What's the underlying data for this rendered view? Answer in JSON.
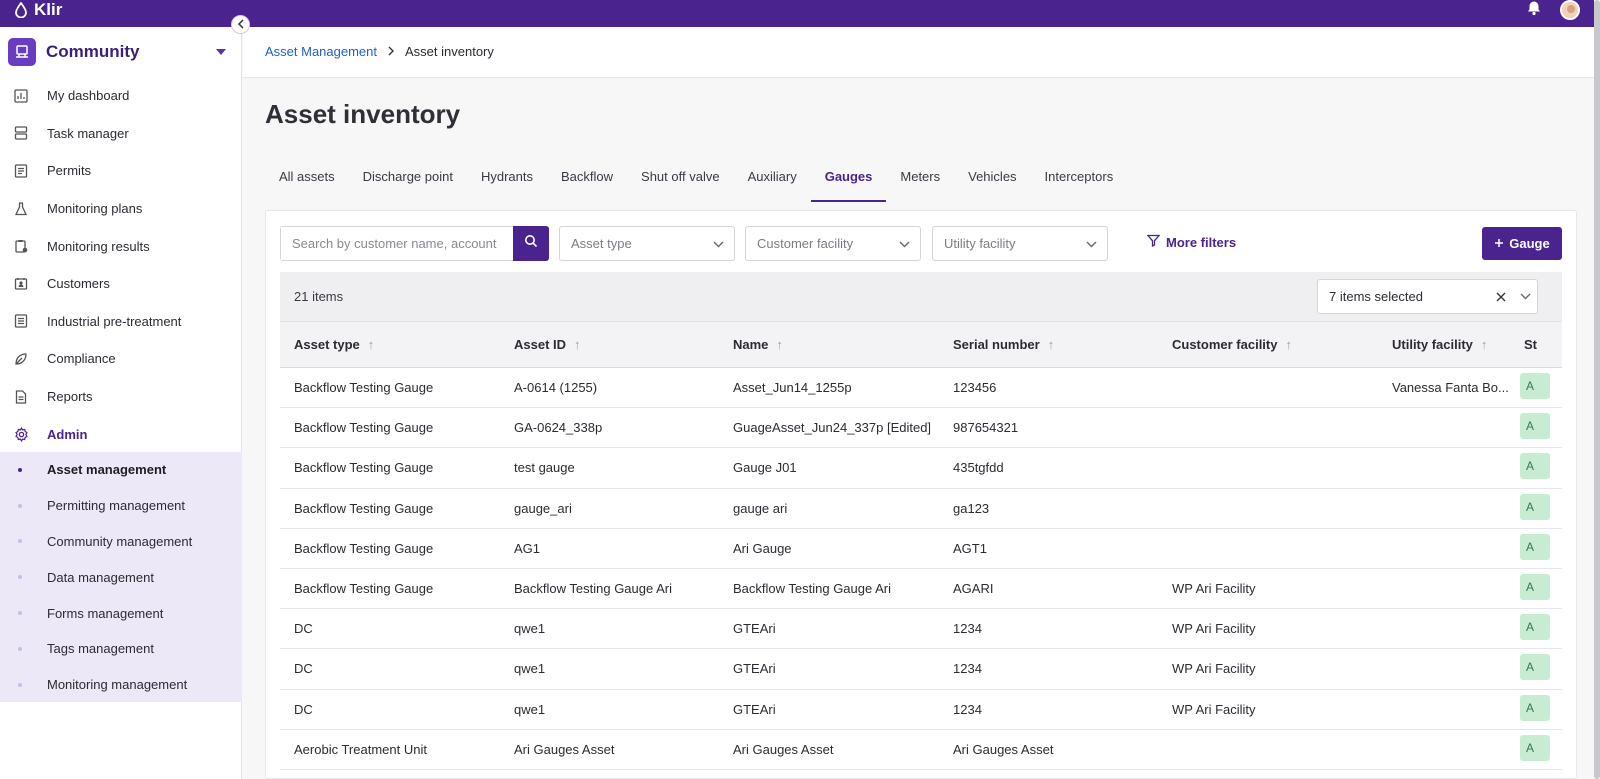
{
  "app": {
    "name": "Klir"
  },
  "sidebar": {
    "community_label": "Community",
    "items": [
      {
        "label": "My dashboard",
        "icon": "chart-icon"
      },
      {
        "label": "Task manager",
        "icon": "tasks-icon"
      },
      {
        "label": "Permits",
        "icon": "document-icon"
      },
      {
        "label": "Monitoring plans",
        "icon": "flask-icon"
      },
      {
        "label": "Monitoring results",
        "icon": "clipboard-icon"
      },
      {
        "label": "Customers",
        "icon": "contacts-icon"
      },
      {
        "label": "Industrial pre-treatment",
        "icon": "list-icon"
      },
      {
        "label": "Compliance",
        "icon": "leaf-icon"
      },
      {
        "label": "Reports",
        "icon": "report-icon"
      },
      {
        "label": "Admin",
        "icon": "gear-icon"
      }
    ],
    "admin_items": [
      "Asset management",
      "Permitting management",
      "Community management",
      "Data management",
      "Forms management",
      "Tags management",
      "Monitoring management"
    ]
  },
  "breadcrumb": {
    "parent": "Asset Management",
    "current": "Asset inventory"
  },
  "page_title": "Asset inventory",
  "tabs": [
    "All assets",
    "Discharge point",
    "Hydrants",
    "Backflow",
    "Shut off valve",
    "Auxiliary",
    "Gauges",
    "Meters",
    "Vehicles",
    "Interceptors"
  ],
  "active_tab": "Gauges",
  "filters": {
    "search_placeholder": "Search by customer name, account",
    "asset_type": "Asset type",
    "customer_facility": "Customer facility",
    "utility_facility": "Utility facility",
    "more_filters": "More filters",
    "add_button": "Gauge"
  },
  "table": {
    "items_count": "21 items",
    "columns_selected": "7 items selected",
    "columns": [
      "Asset type",
      "Asset ID",
      "Name",
      "Serial number",
      "Customer facility",
      "Utility facility",
      "St"
    ],
    "rows": [
      [
        "Backflow Testing Gauge",
        "A-0614 (1255)",
        "Asset_Jun14_1255p",
        "123456",
        "",
        "Vanessa Fanta Bo...",
        "A"
      ],
      [
        "Backflow Testing Gauge",
        "GA-0624_338p",
        "GuageAsset_Jun24_337p [Edited]",
        "987654321",
        "",
        "",
        "A"
      ],
      [
        "Backflow Testing Gauge",
        "test gauge",
        "Gauge J01",
        "435tgfdd",
        "",
        "",
        "A"
      ],
      [
        "Backflow Testing Gauge",
        "gauge_ari",
        "gauge ari",
        "ga123",
        "",
        "",
        "A"
      ],
      [
        "Backflow Testing Gauge",
        "AG1",
        "Ari Gauge",
        "AGT1",
        "",
        "",
        "A"
      ],
      [
        "Backflow Testing Gauge",
        "Backflow Testing Gauge Ari",
        "Backflow Testing Gauge Ari",
        "AGARI",
        "WP Ari Facility",
        "",
        "A"
      ],
      [
        "DC",
        "qwe1",
        "GTEAri",
        "1234",
        "WP Ari Facility",
        "",
        "A"
      ],
      [
        "DC",
        "qwe1",
        "GTEAri",
        "1234",
        "WP Ari Facility",
        "",
        "A"
      ],
      [
        "DC",
        "qwe1",
        "GTEAri",
        "1234",
        "WP Ari Facility",
        "",
        "A"
      ],
      [
        "Aerobic Treatment Unit",
        "Ari Gauges Asset",
        "Ari Gauges Asset",
        "Ari Gauges Asset",
        "",
        "",
        "A"
      ]
    ]
  },
  "colors": {
    "brand": "#4b238f",
    "status_bg": "#c8ecd2",
    "link": "#1f5fc9"
  }
}
